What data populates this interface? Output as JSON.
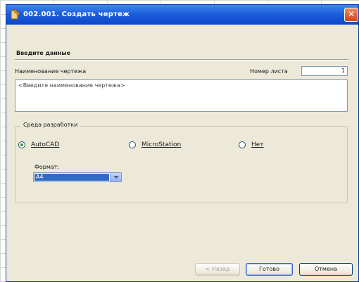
{
  "window": {
    "title": "002.001. Создать чертеж",
    "close_glyph": "✕",
    "accent_color": "#0a47c8"
  },
  "form": {
    "section_title": "Введите данные",
    "name_label": "Наименование чертежа",
    "name_placeholder": "<Введите наименование чертежа>",
    "sheet_label": "Номер листа",
    "sheet_value": "1"
  },
  "environment_group": {
    "legend": "Среда разработки",
    "options": [
      {
        "label": "AutoCAD",
        "selected": true
      },
      {
        "label": "MicroStation",
        "selected": false
      },
      {
        "label": "Нет",
        "selected": false
      }
    ],
    "format_label": "Формат:",
    "format_value": "A4"
  },
  "buttons": {
    "back": "< Назад",
    "ready": "Готово",
    "cancel": "Отмена"
  },
  "icons": {
    "title_icon": "drawing-pencil-icon",
    "close_icon": "close-icon",
    "dropdown_icon": "chevron-down-icon"
  }
}
